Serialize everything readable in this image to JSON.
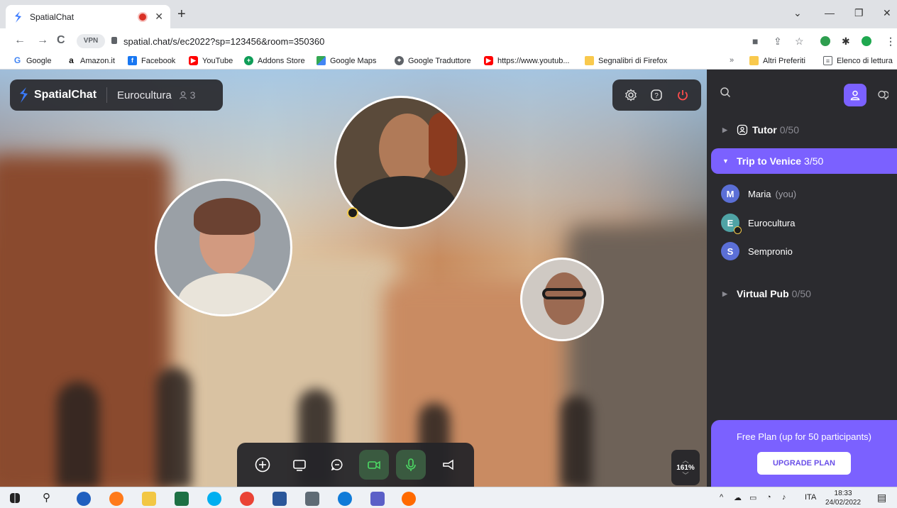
{
  "browser": {
    "tab_title": "SpatialChat",
    "url": "spatial.chat/s/ec2022?sp=123456&room=350360",
    "vpn_label": "VPN",
    "bookmarks": [
      {
        "label": "Google",
        "icon": "google-icon",
        "color": "#4285f4"
      },
      {
        "label": "Amazon.it",
        "icon": "amazon-icon",
        "color": "#111111"
      },
      {
        "label": "Facebook",
        "icon": "facebook-icon",
        "color": "#1877f2"
      },
      {
        "label": "YouTube",
        "icon": "youtube-icon",
        "color": "#ff0000"
      },
      {
        "label": "Addons Store",
        "icon": "addons-icon",
        "color": "#0f9d58"
      },
      {
        "label": "Google Maps",
        "icon": "maps-icon",
        "color": "#34a853"
      },
      {
        "label": "Google Traduttore",
        "icon": "translate-icon",
        "color": "#5f6368"
      },
      {
        "label": "https://www.youtub...",
        "icon": "youtube-icon",
        "color": "#ff0000"
      },
      {
        "label": "Segnalibri di Firefox",
        "icon": "folder-icon",
        "color": "#f9c94d"
      }
    ],
    "other_bookmarks": "Altri Preferiti",
    "reading_list": "Elenco di lettura",
    "overflow": "»"
  },
  "app": {
    "brand": "SpatialChat",
    "space_name": "Eurocultura",
    "online_count": "3",
    "zoom_level": "161%",
    "accent": "#7b61ff",
    "toolbar_buttons": [
      {
        "name": "add-content-button",
        "icon": "plus-circle-icon",
        "active": false
      },
      {
        "name": "share-screen-button",
        "icon": "screen-share-icon",
        "active": false
      },
      {
        "name": "chat-button",
        "icon": "chat-bubble-icon",
        "active": false
      },
      {
        "name": "camera-button",
        "icon": "camera-icon",
        "active": true
      },
      {
        "name": "microphone-button",
        "icon": "microphone-icon",
        "active": true
      },
      {
        "name": "broadcast-button",
        "icon": "megaphone-icon",
        "active": false
      }
    ]
  },
  "sidebar": {
    "rooms": [
      {
        "name": "Tutor",
        "capacity": "0/50",
        "expanded": false,
        "active": false
      },
      {
        "name": "Trip to Venice",
        "capacity": "3/50",
        "expanded": true,
        "active": true
      },
      {
        "name": "Virtual Pub",
        "capacity": "0/50",
        "expanded": false,
        "active": false
      }
    ],
    "members": [
      {
        "initial": "M",
        "name": "Maria",
        "suffix": "(you)",
        "color": "#5b6fd6",
        "host": false
      },
      {
        "initial": "E",
        "name": "Eurocultura",
        "suffix": "",
        "color": "#4fa3a5",
        "host": true
      },
      {
        "initial": "S",
        "name": "Sempronio",
        "suffix": "",
        "color": "#5b6fd6",
        "host": false
      }
    ],
    "plan_text": "Free Plan (up for 50 participants)",
    "upgrade_label": "UPGRADE PLAN"
  },
  "taskbar": {
    "language": "ITA",
    "time": "18:33",
    "date": "24/02/2022"
  }
}
